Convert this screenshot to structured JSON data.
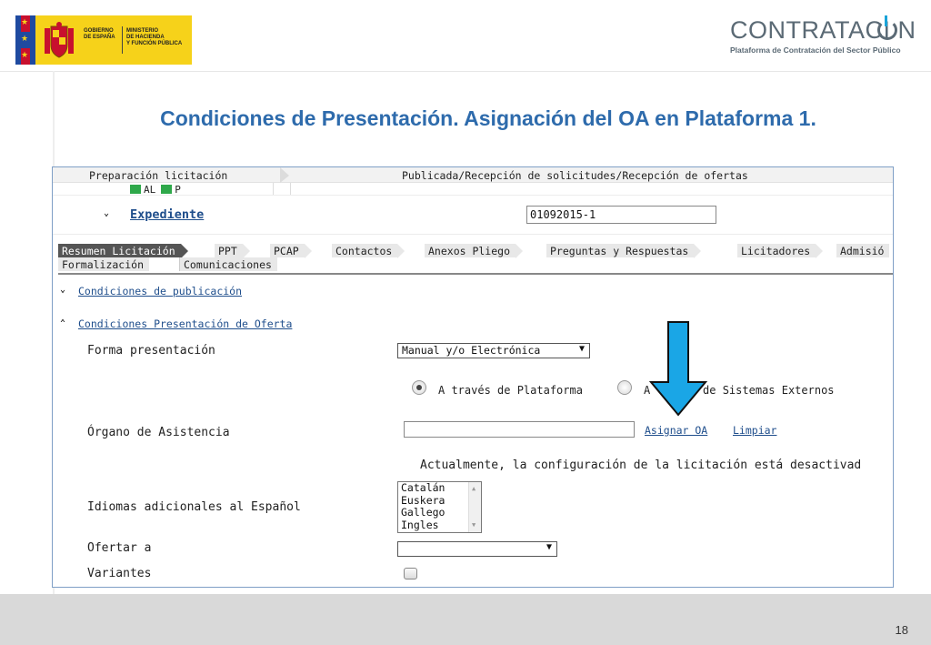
{
  "header": {
    "gov_logo": {
      "line1": "GOBIERNO\nDE ESPAÑA",
      "line2": "MINISTERIO\nDE HACIENDA\nY FUNCIÓN PÚBLICA"
    },
    "brand": {
      "name": "CONTRATACI  N",
      "subtitle": "Plataforma de Contratación del Sector Público",
      "icon": "power-icon"
    }
  },
  "slide": {
    "title": "Condiciones de Presentación. Asignación del OA en Plataforma 1.",
    "page_number": "18"
  },
  "colors": {
    "title_blue": "#2e6bac",
    "link_blue": "#1f4e8c",
    "arrow_blue": "#1aa6e6",
    "status_green": "#2ea84a",
    "footer_gray": "#d9d9d9"
  },
  "screen": {
    "phases": [
      "Preparación licitación",
      "Publicada/Recepción de solicitudes/Recepción de ofertas"
    ],
    "legend": [
      "AL",
      "P"
    ],
    "expediente": {
      "label": "Expediente",
      "value": "01092015-1"
    },
    "tabs_row1": [
      "Resumen Licitación",
      "PPT",
      "PCAP",
      "Contactos",
      "Anexos Pliego",
      "Preguntas y Respuestas",
      "Licitadores",
      "Admisió"
    ],
    "tabs_row2": [
      "Formalización",
      "Comunicaciones"
    ],
    "active_tab": "Resumen Licitación",
    "sections": {
      "publicacion": "Condiciones de publicación",
      "presentacion": "Condiciones Presentación de Oferta"
    },
    "forma_presentacion": {
      "label": "Forma presentación",
      "value": "Manual y/o Electrónica"
    },
    "radios": {
      "plataforma": "A través de Plataforma",
      "externos": "A través de Sistemas Externos",
      "selected": "plataforma"
    },
    "organo": {
      "label": "Órgano de Asistencia",
      "value": "",
      "assign": "Asignar OA",
      "clear": "Limpiar"
    },
    "notice": "Actualmente, la configuración de la licitación está desactivad",
    "idiomas": {
      "label": "Idiomas adicionales al Español",
      "options": [
        "Catalán",
        "Euskera",
        "Gallego",
        "Ingles"
      ]
    },
    "ofertar": {
      "label": "Ofertar a",
      "value": ""
    },
    "variantes": {
      "label": "Variantes",
      "checked": false
    }
  }
}
